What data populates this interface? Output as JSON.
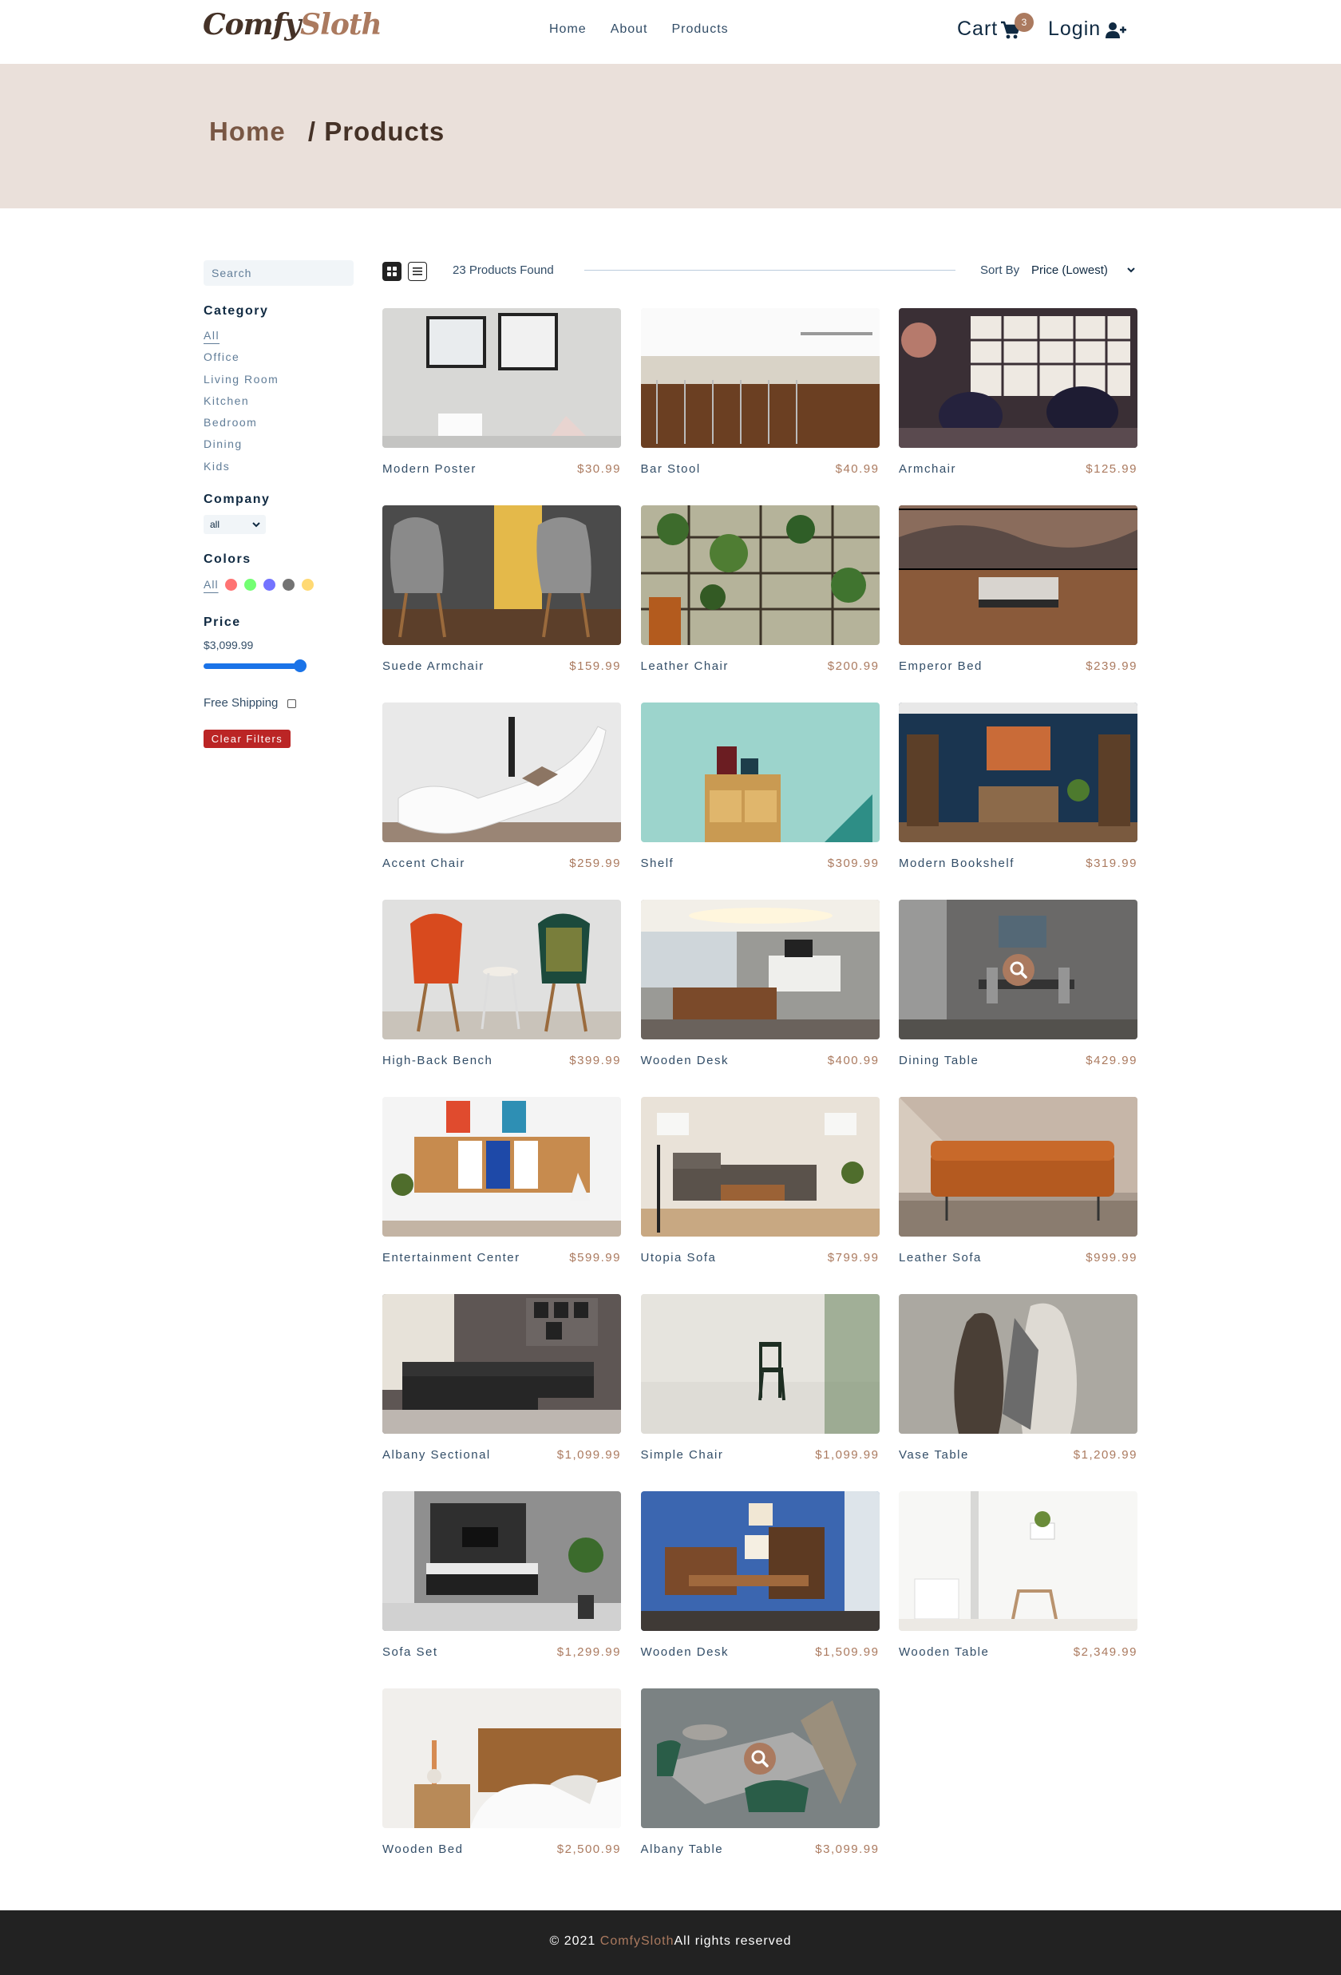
{
  "brand": {
    "part1": "Comfy",
    "part2": "Sloth"
  },
  "nav": {
    "links": [
      "Home",
      "About",
      "Products"
    ]
  },
  "cart": {
    "label": "Cart",
    "count": "3"
  },
  "login": {
    "label": "Login"
  },
  "hero": {
    "home": "Home",
    "separator": "/",
    "current": "Products"
  },
  "filters": {
    "search_placeholder": "Search",
    "category_title": "Category",
    "categories": [
      "All",
      "Office",
      "Living Room",
      "Kitchen",
      "Bedroom",
      "Dining",
      "Kids"
    ],
    "company_title": "Company",
    "company_value": "all",
    "colors_title": "Colors",
    "colors_all": "All",
    "colors": [
      "#ff0000",
      "#00ff00",
      "#0000ff",
      "#000000",
      "#ffb900"
    ],
    "price_title": "Price",
    "price_value": "$3,099.99",
    "price_slider_fraction": 1.0,
    "shipping_label": "Free Shipping",
    "shipping_checked": false,
    "clear_label": "Clear Filters"
  },
  "toolbar": {
    "count_text": "23 Products Found",
    "sort_label": "Sort By",
    "sort_value": "Price (Lowest)"
  },
  "products": [
    {
      "name": "Modern Poster",
      "price": "$30.99",
      "scene": "poster"
    },
    {
      "name": "Bar Stool",
      "price": "$40.99",
      "scene": "kitchen"
    },
    {
      "name": "Armchair",
      "price": "$125.99",
      "scene": "shelves"
    },
    {
      "name": "Suede Armchair",
      "price": "$159.99",
      "scene": "grey-chairs"
    },
    {
      "name": "Leather Chair",
      "price": "$200.99",
      "scene": "plants"
    },
    {
      "name": "Emperor Bed",
      "price": "$239.99",
      "scene": "bed-view"
    },
    {
      "name": "Accent Chair",
      "price": "$259.99",
      "scene": "lounge"
    },
    {
      "name": "Shelf",
      "price": "$309.99",
      "scene": "mint"
    },
    {
      "name": "Modern Bookshelf",
      "price": "$319.99",
      "scene": "blue-room"
    },
    {
      "name": "High-Back Bench",
      "price": "$399.99",
      "scene": "color-chairs"
    },
    {
      "name": "Wooden Desk",
      "price": "$400.99",
      "scene": "office"
    },
    {
      "name": "Dining Table",
      "price": "$429.99",
      "scene": "dining",
      "hover": true
    },
    {
      "name": "Entertainment Center",
      "price": "$599.99",
      "scene": "cabinet"
    },
    {
      "name": "Utopia Sofa",
      "price": "$799.99",
      "scene": "living"
    },
    {
      "name": "Leather Sofa",
      "price": "$999.99",
      "scene": "orange-sofa"
    },
    {
      "name": "Albany Sectional",
      "price": "$1,099.99",
      "scene": "sectional"
    },
    {
      "name": "Simple Chair",
      "price": "$1,099.99",
      "scene": "simple-chair"
    },
    {
      "name": "Vase Table",
      "price": "$1,209.99",
      "scene": "vases"
    },
    {
      "name": "Sofa Set",
      "price": "$1,299.99",
      "scene": "sofa-set"
    },
    {
      "name": "Wooden Desk",
      "price": "$1,509.99",
      "scene": "blue-office"
    },
    {
      "name": "Wooden Table",
      "price": "$2,349.99",
      "scene": "white-room"
    },
    {
      "name": "Wooden Bed",
      "price": "$2,500.99",
      "scene": "wood-bed"
    },
    {
      "name": "Albany Table",
      "price": "$3,099.99",
      "scene": "table-chairs",
      "hover": true
    }
  ],
  "footer": {
    "prefix": "© 2021",
    "brand": "ComfySloth",
    "suffix": "All rights reserved"
  }
}
